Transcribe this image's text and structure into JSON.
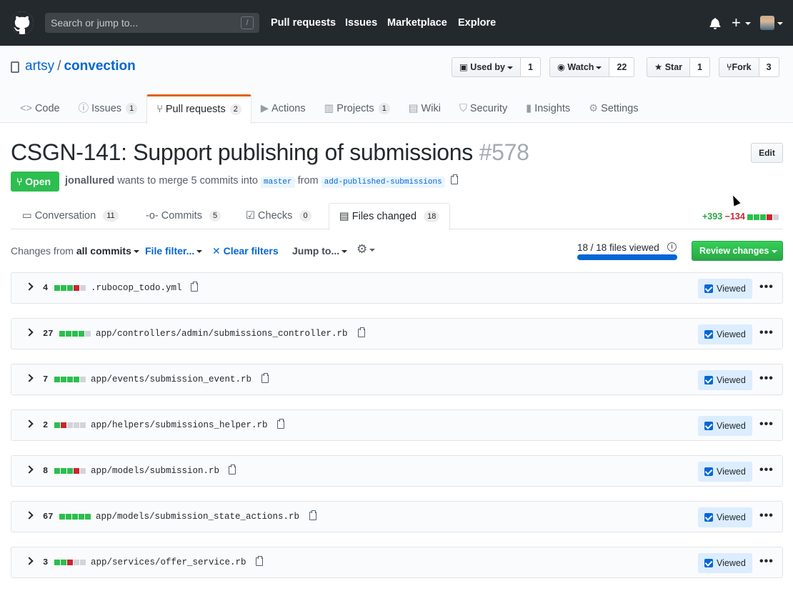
{
  "header": {
    "search_placeholder": "Search or jump to...",
    "search_key": "/",
    "nav": [
      "Pull requests",
      "Issues",
      "Marketplace",
      "Explore"
    ],
    "plus": "+"
  },
  "repo": {
    "owner": "artsy",
    "separator": "/",
    "name": "convection",
    "used_by_label": "Used by",
    "used_by_count": "1",
    "watch_label": "Watch",
    "watch_count": "22",
    "star_label": "Star",
    "star_count": "1",
    "fork_label": "Fork",
    "fork_count": "3",
    "tabs": [
      {
        "icon": "<>",
        "label": "Code",
        "count": ""
      },
      {
        "icon": "ⓘ",
        "label": "Issues",
        "count": "1"
      },
      {
        "icon": "⑂",
        "label": "Pull requests",
        "count": "2"
      },
      {
        "icon": "▶",
        "label": "Actions",
        "count": ""
      },
      {
        "icon": "▥",
        "label": "Projects",
        "count": "1"
      },
      {
        "icon": "▤",
        "label": "Wiki",
        "count": ""
      },
      {
        "icon": "⛉",
        "label": "Security",
        "count": ""
      },
      {
        "icon": "▮",
        "label": "Insights",
        "count": ""
      },
      {
        "icon": "⚙",
        "label": "Settings",
        "count": ""
      }
    ]
  },
  "pr": {
    "title": "CSGN-141: Support publishing of submissions",
    "number": "#578",
    "edit_label": "Edit",
    "state": "Open",
    "author": "jonallured",
    "merge_text_1": "wants to merge 5 commits into",
    "base_branch": "master",
    "merge_text_2": "from",
    "head_branch": "add-published-submissions",
    "tabs": [
      {
        "label": "Conversation",
        "count": "11"
      },
      {
        "label": "Commits",
        "count": "5"
      },
      {
        "label": "Checks",
        "count": "0"
      },
      {
        "label": "Files changed",
        "count": "18"
      }
    ],
    "additions": "+393",
    "deletions": "−134"
  },
  "toolbar": {
    "changes_from": "Changes from",
    "all_commits": "all commits",
    "file_filter": "File filter...",
    "clear_filters": "Clear filters",
    "clear_x": "✕",
    "jump_to": "Jump to...",
    "viewed_progress": "18 / 18 files viewed",
    "viewed_fraction": 1.0,
    "review_changes": "Review changes"
  },
  "files": [
    {
      "count": "4",
      "blocks": [
        "add",
        "add",
        "add",
        "del",
        "neu"
      ],
      "path": ".rubocop_todo.yml",
      "viewed_label": "Viewed"
    },
    {
      "count": "27",
      "blocks": [
        "add",
        "add",
        "add",
        "add",
        "neu"
      ],
      "path": "app/controllers/admin/submissions_controller.rb",
      "viewed_label": "Viewed"
    },
    {
      "count": "7",
      "blocks": [
        "add",
        "add",
        "add",
        "add",
        "neu"
      ],
      "path": "app/events/submission_event.rb",
      "viewed_label": "Viewed"
    },
    {
      "count": "2",
      "blocks": [
        "add",
        "del",
        "neu",
        "neu",
        "neu"
      ],
      "path": "app/helpers/submissions_helper.rb",
      "viewed_label": "Viewed"
    },
    {
      "count": "8",
      "blocks": [
        "add",
        "add",
        "add",
        "del",
        "neu"
      ],
      "path": "app/models/submission.rb",
      "viewed_label": "Viewed"
    },
    {
      "count": "67",
      "blocks": [
        "add",
        "add",
        "add",
        "add",
        "add"
      ],
      "path": "app/models/submission_state_actions.rb",
      "viewed_label": "Viewed"
    },
    {
      "count": "3",
      "blocks": [
        "add",
        "add",
        "del",
        "neu",
        "neu"
      ],
      "path": "app/services/offer_service.rb",
      "viewed_label": "Viewed"
    }
  ],
  "colors": {
    "header_bg": "#24292e",
    "link": "#0366d6",
    "open_green": "#2cbe4e",
    "addition": "#28a745",
    "deletion": "#cb2431",
    "tab_accent": "#e36209"
  }
}
